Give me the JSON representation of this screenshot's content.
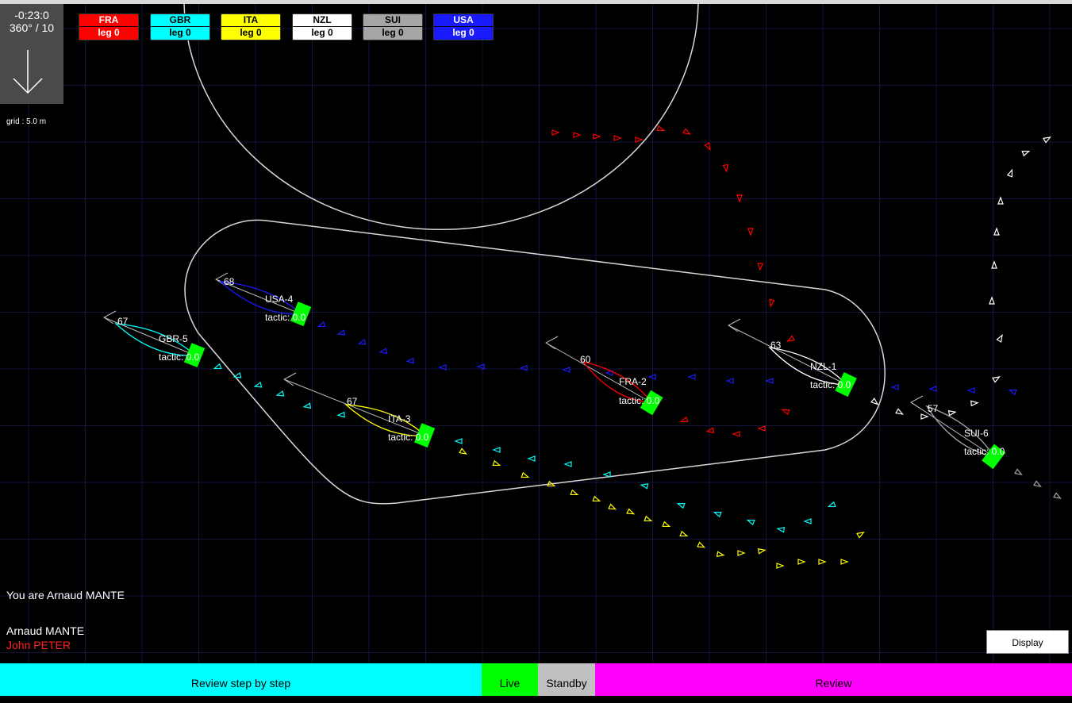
{
  "wind": {
    "time": "-0:23:0",
    "direction": "360° / 10"
  },
  "grid_label": "grid : 5.0 m",
  "legend": [
    {
      "code": "FRA",
      "leg": "leg 0",
      "bg": "#ff0000",
      "fg": "#ffffff"
    },
    {
      "code": "GBR",
      "leg": "leg 0",
      "bg": "#00ffff",
      "fg": "#000000"
    },
    {
      "code": "ITA",
      "leg": "leg 0",
      "bg": "#ffff00",
      "fg": "#000000"
    },
    {
      "code": "NZL",
      "leg": "leg 0",
      "bg": "#ffffff",
      "fg": "#000000"
    },
    {
      "code": "SUI",
      "leg": "leg 0",
      "bg": "#a6a6a6",
      "fg": "#000000"
    },
    {
      "code": "USA",
      "leg": "leg 0",
      "bg": "#1a1aff",
      "fg": "#ffffff"
    }
  ],
  "boats": [
    {
      "id": "USA-4",
      "speed": "68",
      "tactic": "tactic: 0.0",
      "color": "#1a1aff"
    },
    {
      "id": "GBR-5",
      "speed": "67",
      "tactic": "tactic: 0.0",
      "color": "#00ffff"
    },
    {
      "id": "ITA-3",
      "speed": "67",
      "tactic": "tactic: 0.0",
      "color": "#ffff00"
    },
    {
      "id": "FRA-2",
      "speed": "60",
      "tactic": "tactic: 0.0",
      "color": "#ff0000"
    },
    {
      "id": "NZL-1",
      "speed": "63",
      "tactic": "tactic: 0.0",
      "color": "#ffffff"
    },
    {
      "id": "SUI-6",
      "speed": "57",
      "tactic": "tactic: 0.0",
      "color": "#a6a6a6"
    }
  ],
  "you_are": "You are Arnaud MANTE",
  "users": [
    {
      "name": "Arnaud MANTE",
      "color": "#ffffff"
    },
    {
      "name": "John PETER",
      "color": "#ff2020"
    }
  ],
  "display_button": "Display",
  "bottom_bar": {
    "review_step": "Review step by step",
    "live": "Live",
    "standby": "Standby",
    "review": "Review"
  },
  "colors": {
    "grid": "#14143c",
    "course": "#d8d8d8",
    "tactic_box": "#00ff00"
  }
}
